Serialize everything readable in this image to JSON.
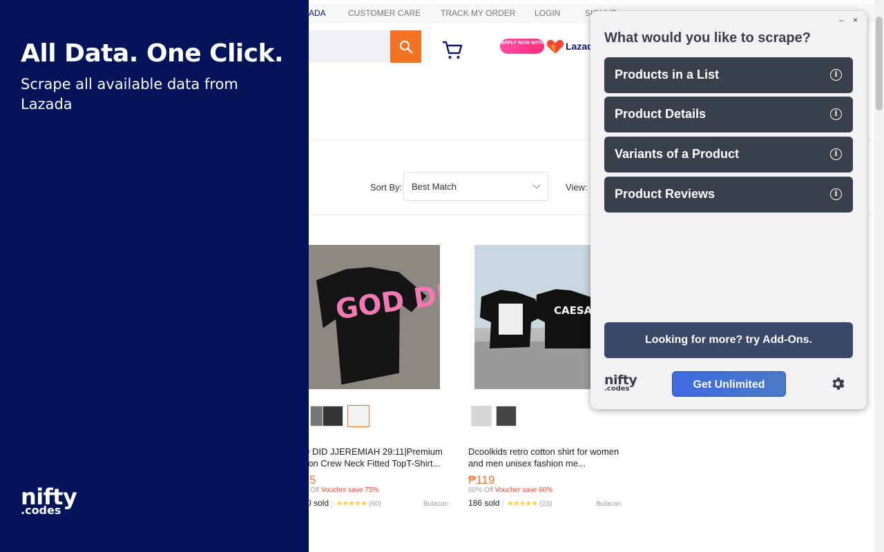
{
  "promo": {
    "headline": "All Data. One Click.",
    "subtext": "Scrape all available data from Lazada",
    "logo_line1": "nifty",
    "logo_line2": ".codes"
  },
  "site": {
    "topnav": [
      "ADA",
      "CUSTOMER CARE",
      "TRACK MY ORDER",
      "LOGIN",
      "SIGNUP"
    ],
    "apply_now": "APPLY NOW WITH",
    "brand": "Lazada",
    "sort_label": "Sort By:",
    "sort_value": "Best Match",
    "view_label": "View:",
    "products": [
      {
        "image_text": "GOD DID",
        "name": "D DID JJEREMIAH 29:11|Premium tton Crew Neck Fitted TopT-Shirt...",
        "price": "5",
        "discount": "Off",
        "voucher": "Voucher save 75%",
        "sold": "0 sold",
        "stars": "★★★★★",
        "reviews": "(60)",
        "location": "Bulacan"
      },
      {
        "image_text": "CAESAR",
        "name": "Dcoolkids retro cotton shirt for women and men unisex fashion me...",
        "price": "₱119",
        "discount": "60% Off",
        "voucher": "Voucher save 60%",
        "sold": "186 sold",
        "stars": "★★★★★",
        "reviews": "(23)",
        "location": "Bulacan"
      }
    ]
  },
  "popup": {
    "minimize": "–",
    "close": "×",
    "title": "What would you like to scrape?",
    "options": [
      {
        "label": "Products in a List",
        "info": "i"
      },
      {
        "label": "Product Details",
        "info": "i"
      },
      {
        "label": "Variants of a Product",
        "info": "i"
      },
      {
        "label": "Product Reviews",
        "info": "i"
      }
    ],
    "addons_label": "Looking for more? try Add-Ons.",
    "logo_line1": "nifty",
    "logo_line2": ".codes",
    "unlimited_label": "Get Unlimited"
  },
  "colors": {
    "promo_bg": "#03135a",
    "lazada_orange": "#f57224",
    "option_bg": "#3a3f4c",
    "addons_bg": "#394868",
    "unlimited_bg": "#3d6be0"
  },
  "icons": [
    "search-icon",
    "cart-icon",
    "lazada-heart-icon",
    "info-icon",
    "gear-icon"
  ]
}
